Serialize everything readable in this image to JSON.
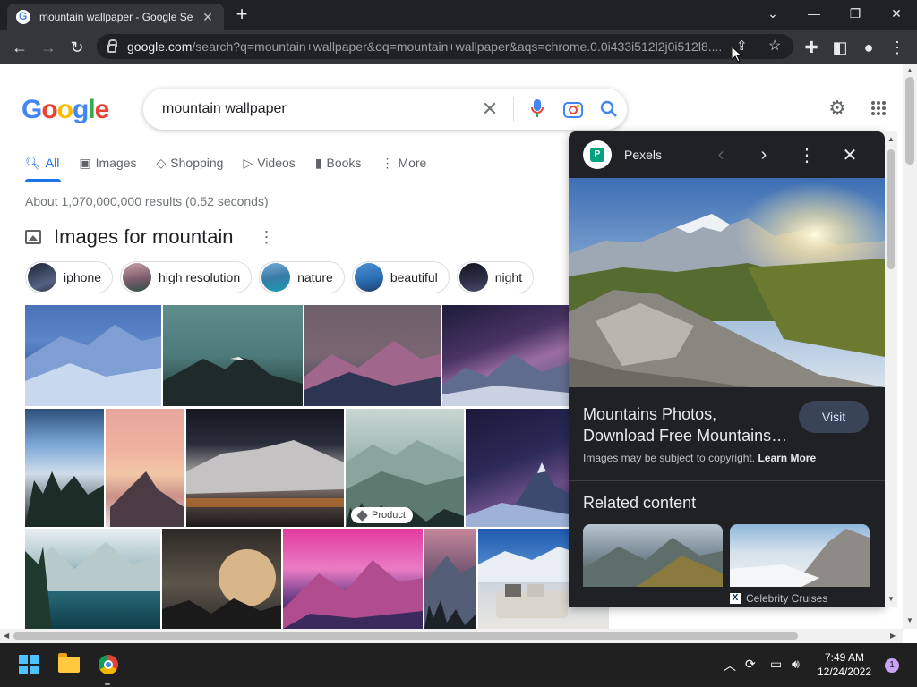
{
  "browser": {
    "tab_title": "mountain wallpaper - Google Se",
    "url_host": "google.com",
    "url_rest": "/search?q=mountain+wallpaper&oq=mountain+wallpaper&aqs=chrome.0.0i433i512l2j0i512l8....",
    "new_tab_label": "+"
  },
  "search": {
    "query": "mountain wallpaper"
  },
  "nav_tabs": [
    {
      "label": "All",
      "icon": "search-icon",
      "active": true
    },
    {
      "label": "Images",
      "icon": "image-icon"
    },
    {
      "label": "Shopping",
      "icon": "tag-icon"
    },
    {
      "label": "Videos",
      "icon": "play-icon"
    },
    {
      "label": "Books",
      "icon": "book-icon"
    },
    {
      "label": "More",
      "icon": "more-vert-icon"
    }
  ],
  "results_stats": "About 1,070,000,000 results (0.52 seconds)",
  "images_section": {
    "title": "Images for mountain",
    "chips": [
      "iphone",
      "high resolution",
      "nature",
      "beautiful",
      "night"
    ],
    "product_badge": "Product"
  },
  "panel": {
    "source_name": "Pexels",
    "title_line1": "Mountains Photos,",
    "title_line2": "Download Free Mountains…",
    "visit_label": "Visit",
    "copyright_text": "Images may be subject to copyright.",
    "learn_more": "Learn More",
    "related_heading": "Related content",
    "related_source": "Celebrity Cruises"
  },
  "taskbar": {
    "time": "7:49 AM",
    "date": "12/24/2022",
    "notification_count": "1"
  },
  "colors": {
    "accent": "#1a73e8",
    "chrome_dark": "#202124",
    "visit_button": "#394457"
  }
}
